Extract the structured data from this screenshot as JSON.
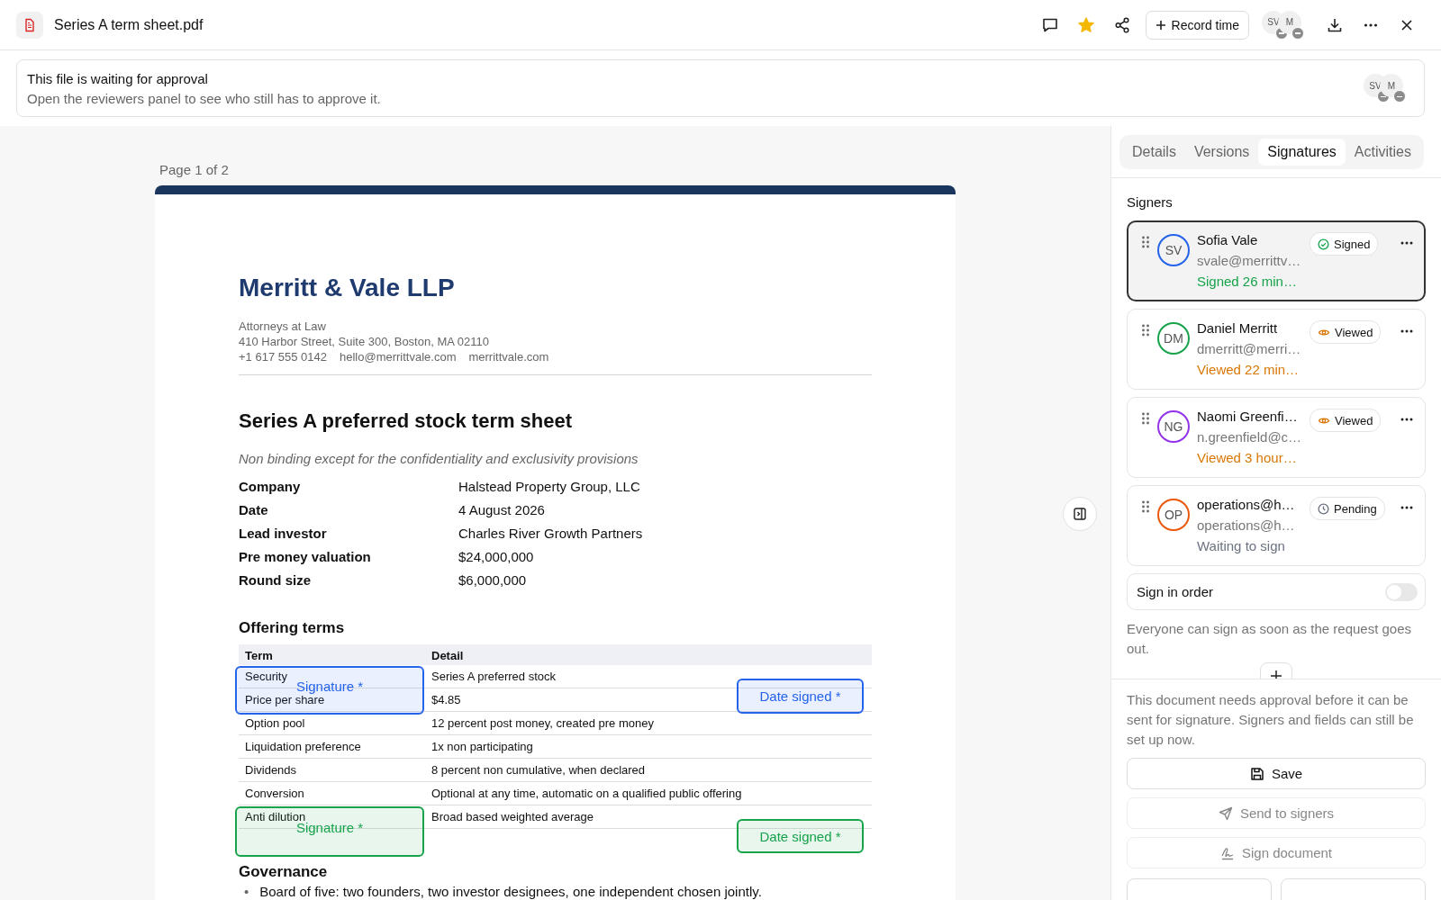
{
  "file": {
    "title": "Series A term sheet.pdf",
    "starred": true
  },
  "toolbar": {
    "record_button": "Record time",
    "avatars": [
      {
        "initials": "SV"
      },
      {
        "initials": "M"
      }
    ]
  },
  "approval_banner": {
    "title": "This file is waiting for approval",
    "text": "Open the reviewers panel to see who still has to approve it.",
    "avatars": [
      {
        "initials": "SV"
      },
      {
        "initials": "M"
      }
    ]
  },
  "document": {
    "page_label": "Page 1 of 2",
    "firm": {
      "name": "Merritt & Vale LLP",
      "tagline": "Attorneys at Law",
      "address": "410 Harbor Street, Suite 300, Boston, MA 02110",
      "contacts": [
        "+1 617 555 0142",
        "hello@merrittvale.com",
        "merrittvale.com"
      ]
    },
    "title": "Series A preferred stock term sheet",
    "subtitle": "Non binding except for the confidentiality and exclusivity provisions",
    "facts": [
      {
        "label": "Company",
        "value": "Halstead Property Group, LLC"
      },
      {
        "label": "Date",
        "value": "4 August 2026"
      },
      {
        "label": "Lead investor",
        "value": "Charles River Growth Partners"
      },
      {
        "label": "Pre money valuation",
        "value": "$24,000,000"
      },
      {
        "label": "Round size",
        "value": "$6,000,000"
      }
    ],
    "section": "Offering terms",
    "table": {
      "columns": [
        "Term",
        "Detail"
      ],
      "rows": [
        [
          "Security",
          "Series A preferred stock"
        ],
        [
          "Price per share",
          "$4.85"
        ],
        [
          "Option pool",
          "12 percent post money, created pre money"
        ],
        [
          "Liquidation preference",
          "1x non participating"
        ],
        [
          "Dividends",
          "8 percent non cumulative, when declared"
        ],
        [
          "Conversion",
          "Optional at any time, automatic on a qualified public offering"
        ],
        [
          "Anti dilution",
          "Broad based weighted average"
        ]
      ]
    },
    "fields": [
      {
        "kind": "signature",
        "label": "Signature *",
        "color": "#2563eb"
      },
      {
        "kind": "date",
        "label": "Date signed *",
        "color": "#2563eb"
      },
      {
        "kind": "signature",
        "label": "Signature *",
        "color": "#16a34a"
      },
      {
        "kind": "date",
        "label": "Date signed *",
        "color": "#16a34a"
      }
    ],
    "next_section": "Governance",
    "bullets": [
      {
        "marker": "•",
        "text": "Board of five: two founders, two investor designees, one independent chosen jointly."
      }
    ]
  },
  "panel": {
    "tabs": [
      {
        "label": "Details",
        "selected": false
      },
      {
        "label": "Versions",
        "selected": false
      },
      {
        "label": "Signatures",
        "selected": true
      },
      {
        "label": "Activities",
        "selected": false
      }
    ],
    "signers_heading": "Signers",
    "signers": [
      {
        "initials": "SV",
        "name": "Sofia Vale",
        "email": "svale@merrittv…",
        "activity": "Signed 26 min…",
        "kind": "signed",
        "status_label": "Signed",
        "color": "#2563eb",
        "selected": true
      },
      {
        "initials": "DM",
        "name": "Daniel Merritt",
        "email": "dmerritt@merri…",
        "activity": "Viewed 22 min…",
        "kind": "viewed",
        "status_label": "Viewed",
        "color": "#16a34a",
        "selected": false
      },
      {
        "initials": "NG",
        "name": "Naomi Greenfi…",
        "email": "n.greenfield@c…",
        "activity": "Viewed 3 hour…",
        "kind": "viewed",
        "status_label": "Viewed",
        "color": "#9333ea",
        "selected": false
      },
      {
        "initials": "OP",
        "name": "operations@h…",
        "email": "operations@h…",
        "activity": "Waiting to sign",
        "kind": "pending",
        "status_label": "Pending",
        "color": "#ea580c",
        "selected": false
      }
    ],
    "sign_in_order": {
      "label": "Sign in order",
      "on": false
    },
    "order_note": "Everyone can sign as soon as the request goes out.",
    "approval_note": "This document needs approval before it can be sent for signature. Signers and fields can still be set up now.",
    "buttons": [
      {
        "kind": "save",
        "label": "Save",
        "disabled": false
      },
      {
        "kind": "send",
        "label": "Send to signers",
        "disabled": true
      },
      {
        "kind": "sign",
        "label": "Sign document",
        "disabled": true
      }
    ]
  }
}
